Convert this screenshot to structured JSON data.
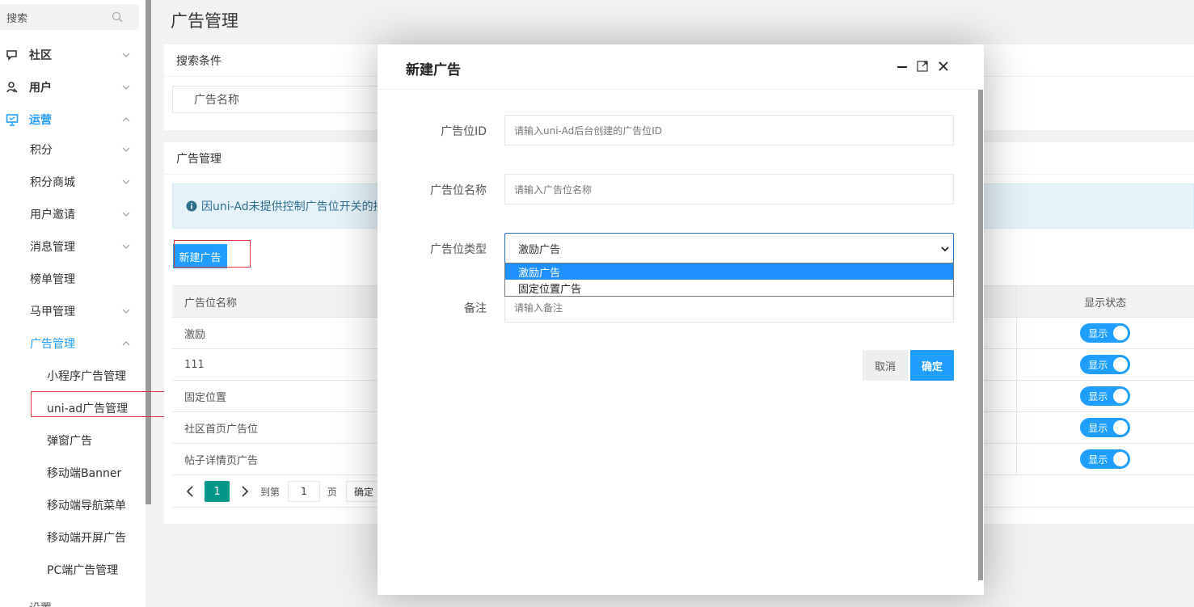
{
  "sidebar": {
    "search_placeholder": "搜索",
    "items": [
      {
        "label": "社区"
      },
      {
        "label": "用户"
      },
      {
        "label": "运营"
      }
    ],
    "sub_items": [
      {
        "label": "积分"
      },
      {
        "label": "积分商城"
      },
      {
        "label": "用户邀请"
      },
      {
        "label": "消息管理"
      },
      {
        "label": "榜单管理"
      },
      {
        "label": "马甲管理"
      },
      {
        "label": "广告管理"
      }
    ],
    "leaf_items": [
      {
        "label": "小程序广告管理"
      },
      {
        "label": "uni-ad广告管理"
      },
      {
        "label": "弹窗广告"
      },
      {
        "label": "移动端Banner"
      },
      {
        "label": "移动端导航菜单"
      },
      {
        "label": "移动端开屏广告"
      },
      {
        "label": "PC端广告管理"
      }
    ],
    "cut_item": "设置"
  },
  "main": {
    "page_title": "广告管理",
    "search_card_title": "搜索条件",
    "search_field_label": "广告名称",
    "list_card_title": "广告管理",
    "notice_text": "因uni-Ad未提供控制广告位开关的接",
    "new_button": "新建广告",
    "table": {
      "col_name": "广告位名称",
      "col_status": "显示状态",
      "rows": [
        {
          "name": "激励",
          "status": "显示"
        },
        {
          "name": "111",
          "status": "显示"
        },
        {
          "name": "固定位置",
          "status": "显示"
        },
        {
          "name": "社区首页广告位",
          "status": "显示"
        },
        {
          "name": "帖子详情页广告",
          "status": "显示"
        }
      ]
    },
    "pager": {
      "current": "1",
      "goto_label": "到第",
      "page_input": "1",
      "page_unit": "页",
      "go_button": "确定"
    }
  },
  "modal": {
    "title": "新建广告",
    "fields": {
      "ad_id_label": "广告位ID",
      "ad_id_placeholder": "请输入uni-Ad后台创建的广告位ID",
      "ad_name_label": "广告位名称",
      "ad_name_placeholder": "请输入广告位名称",
      "ad_type_label": "广告位类型",
      "ad_type_value": "激励广告",
      "ad_type_options": [
        "激励广告",
        "固定位置广告"
      ],
      "remark_label": "备注",
      "remark_placeholder": "请输入备注"
    },
    "cancel_button": "取消",
    "ok_button": "确定"
  },
  "colors": {
    "accent": "#1e9fff",
    "pager_active": "#009688",
    "highlight_box": "#d9363e"
  }
}
